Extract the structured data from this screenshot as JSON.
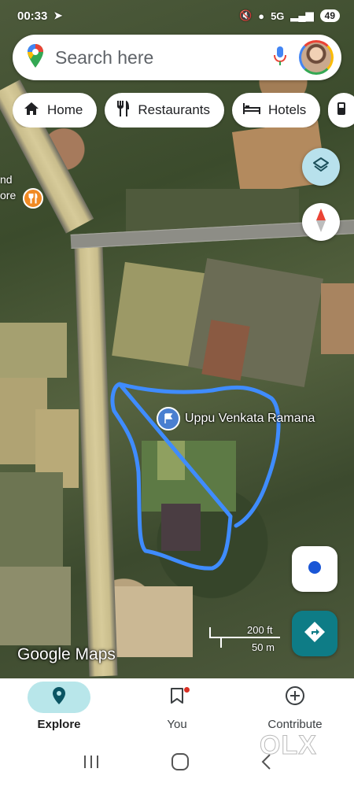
{
  "status_bar": {
    "time": "00:33",
    "battery": "49",
    "signal_label": "5G"
  },
  "search": {
    "placeholder": "Search here"
  },
  "chips": [
    {
      "label": "Home",
      "icon": "home-icon"
    },
    {
      "label": "Restaurants",
      "icon": "restaurant-icon"
    },
    {
      "label": "Hotels",
      "icon": "hotel-icon"
    }
  ],
  "map": {
    "place_label": "Uppu Venkata Ramana",
    "nearby_label": "nd\nore",
    "scale_feet": "200 ft",
    "scale_meters": "50 m",
    "logo": "Google Maps",
    "boundary_color": "#3f8cff"
  },
  "bottom_nav": [
    {
      "label": "Explore",
      "icon": "explore-pin-icon",
      "active": true
    },
    {
      "label": "You",
      "icon": "bookmark-icon",
      "active": false
    },
    {
      "label": "Contribute",
      "icon": "add-circle-icon",
      "active": false
    }
  ],
  "watermark": "OLX",
  "colors": {
    "accent": "#0e7c86",
    "active_tab": "#b8e6ea",
    "layers_button": "#b8e1ec"
  }
}
